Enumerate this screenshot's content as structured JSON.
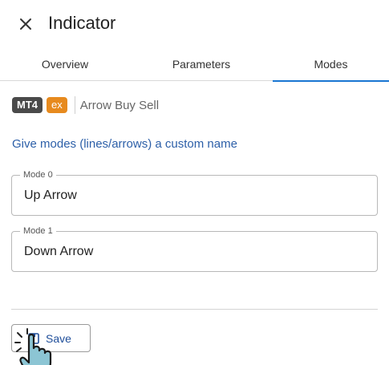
{
  "header": {
    "title": "Indicator",
    "close_icon": "close-icon"
  },
  "tabs": [
    {
      "label": "Overview",
      "active": false
    },
    {
      "label": "Parameters",
      "active": false
    },
    {
      "label": "Modes",
      "active": true
    }
  ],
  "meta": {
    "platform_badge": "MT4",
    "type_badge": "ex",
    "indicator_name": "Arrow Buy Sell",
    "badge_colors": {
      "platform": "#4a4a4a",
      "type": "#e78a1e"
    }
  },
  "help_link": "Give modes (lines/arrows) a custom name",
  "modes": [
    {
      "label": "Mode 0",
      "value": "Up Arrow"
    },
    {
      "label": "Mode 1",
      "value": "Down Arrow"
    }
  ],
  "actions": {
    "save_label": "Save",
    "save_icon": "floppy-disk-icon"
  },
  "colors": {
    "accent": "#1976d2",
    "link": "#2c5fa8"
  },
  "pointer": {
    "icon": "hand-pointer-cursor-icon"
  }
}
